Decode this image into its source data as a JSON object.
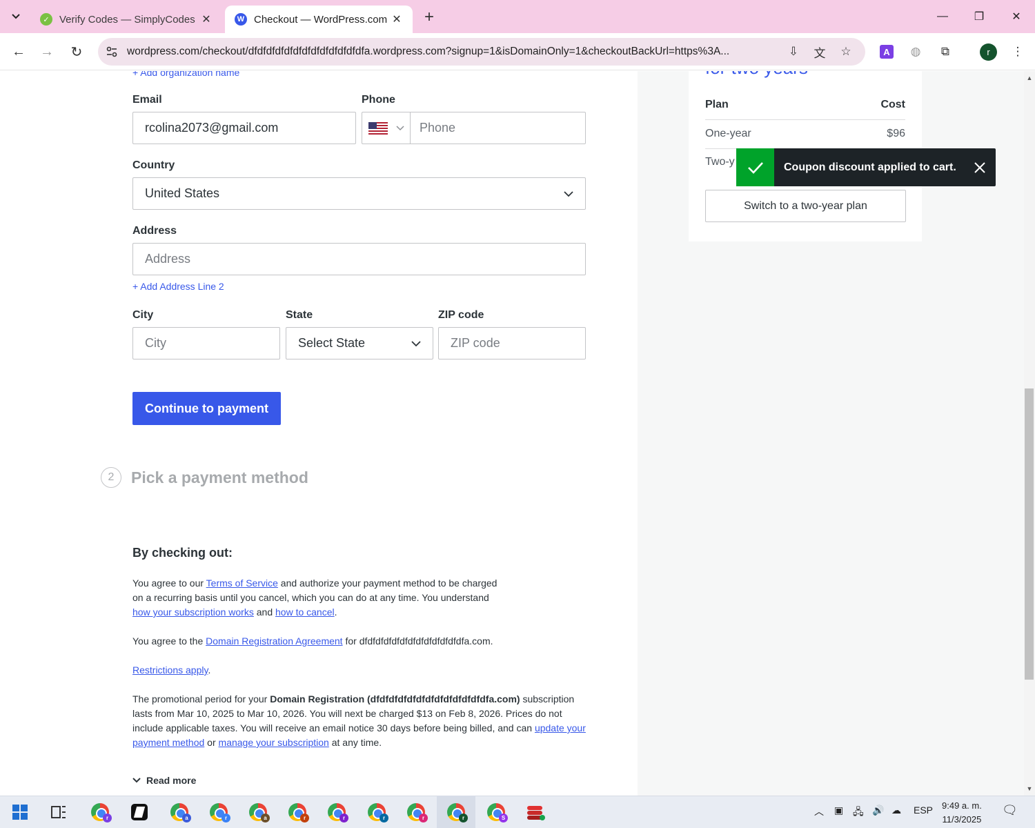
{
  "browser": {
    "tabs": [
      {
        "title": "Verify Codes — SimplyCodes",
        "active": false
      },
      {
        "title": "Checkout — WordPress.com",
        "active": true
      }
    ],
    "url": "wordpress.com/checkout/dfdfdfdfdfdfdfdfdfdfdfdfdfa.wordpress.com?signup=1&isDomainOnly=1&checkoutBackUrl=https%3A...",
    "profile_initial": "r"
  },
  "form": {
    "add_org_link": "+ Add organization name",
    "email_label": "Email",
    "email_value": "rcolina2073@gmail.com",
    "phone_label": "Phone",
    "phone_placeholder": "Phone",
    "country_label": "Country",
    "country_value": "United States",
    "address_label": "Address",
    "address_placeholder": "Address",
    "add_line2_link": "+ Add Address Line 2",
    "city_label": "City",
    "city_placeholder": "City",
    "state_label": "State",
    "state_value": "Select State",
    "zip_label": "ZIP code",
    "zip_placeholder": "ZIP code",
    "continue_button": "Continue to payment"
  },
  "step2": {
    "number": "2",
    "title": "Pick a payment method"
  },
  "terms": {
    "heading": "By checking out:",
    "p1_a": "You agree to our ",
    "p1_link1": "Terms of Service",
    "p1_b": " and authorize your payment method to be charged on a recurring basis until you cancel, which you can do at any time. You understand ",
    "p1_link2": "how your subscription works",
    "p1_c": " and ",
    "p1_link3": "how to cancel",
    "p1_d": ".",
    "p2_a": "You agree to the ",
    "p2_link": "Domain Registration Agreement",
    "p2_b": " for dfdfdfdfdfdfdfdfdfdfdfdfdfa.com.",
    "p3_link": "Restrictions apply",
    "p3_b": ".",
    "p4_a": "The promotional period for your ",
    "p4_bold": "Domain Registration (dfdfdfdfdfdfdfdfdfdfdfdfdfa.com)",
    "p4_b": " subscription lasts from Mar 10, 2025 to Mar 10, 2026. You will next be charged $13 on Feb 8, 2026. Prices do not include applicable taxes. You will receive an email notice 30 days before being billed, and can ",
    "p4_link1": "update your payment method",
    "p4_c": " or ",
    "p4_link2": "manage your subscription",
    "p4_d": " at any time.",
    "read_more": "Read more"
  },
  "sidebar": {
    "heading_partial": "for two years",
    "plan_header": "Plan",
    "cost_header": "Cost",
    "rows": [
      {
        "plan": "One-year",
        "cost": "$96"
      },
      {
        "plan": "Two-y",
        "cost": ""
      }
    ],
    "switch_button": "Switch to a two-year plan"
  },
  "toast": {
    "message": "Coupon discount applied to cart."
  },
  "taskbar": {
    "language": "ESP",
    "time": "9:49 a. m.",
    "date": "11/3/2025"
  },
  "colors": {
    "accent": "#3858e9",
    "success": "#00a32a",
    "tab_bar": "#f6cde6"
  }
}
